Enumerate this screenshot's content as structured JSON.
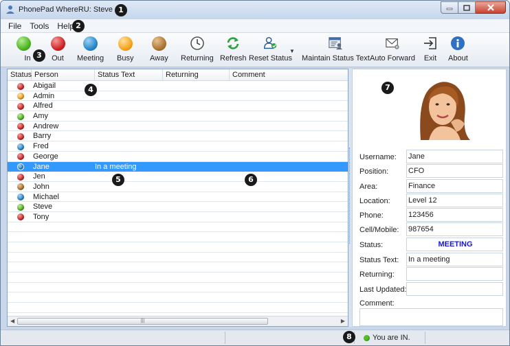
{
  "window": {
    "title": "PhonePad WhereRU: Steve"
  },
  "menu": [
    "File",
    "Tools",
    "Help"
  ],
  "toolbar": {
    "in": "In",
    "out": "Out",
    "meeting": "Meeting",
    "busy": "Busy",
    "away": "Away",
    "returning": "Returning",
    "refresh": "Refresh",
    "reset_status": "Reset Status",
    "maintain": "Maintain Status Text",
    "auto_forward": "Auto Forward",
    "exit": "Exit",
    "about": "About"
  },
  "colors": {
    "in": "#59c42a",
    "out": "#d22a2a",
    "meeting": "#2b86c9",
    "busy": "#f5a623",
    "away": "#b07a3a",
    "selection": "#3399ff",
    "status_text": "#1515d6"
  },
  "grid": {
    "columns": [
      "Status",
      "Person",
      "Status Text",
      "Returning",
      "Comment"
    ],
    "rows": [
      {
        "name": "Abigail",
        "status": "out",
        "status_text": ""
      },
      {
        "name": "Admin",
        "status": "busy",
        "status_text": ""
      },
      {
        "name": "Alfred",
        "status": "out",
        "status_text": ""
      },
      {
        "name": "Amy",
        "status": "in",
        "status_text": ""
      },
      {
        "name": "Andrew",
        "status": "out",
        "status_text": ""
      },
      {
        "name": "Barry",
        "status": "out",
        "status_text": ""
      },
      {
        "name": "Fred",
        "status": "meeting",
        "status_text": ""
      },
      {
        "name": "George",
        "status": "out",
        "status_text": ""
      },
      {
        "name": "Jane",
        "status": "meeting",
        "status_text": "In a meeting",
        "selected": true
      },
      {
        "name": "Jen",
        "status": "out",
        "status_text": ""
      },
      {
        "name": "John",
        "status": "away",
        "status_text": ""
      },
      {
        "name": "Michael",
        "status": "meeting",
        "status_text": ""
      },
      {
        "name": "Steve",
        "status": "in",
        "status_text": ""
      },
      {
        "name": "Tony",
        "status": "out",
        "status_text": ""
      }
    ],
    "blank_rows": 9
  },
  "detail": {
    "labels": {
      "username": "Username:",
      "position": "Position:",
      "area": "Area:",
      "location": "Location:",
      "phone": "Phone:",
      "cell": "Cell/Mobile:",
      "status": "Status:",
      "status_text": "Status Text:",
      "returning": "Returning:",
      "last_updated": "Last Updated:",
      "comment": "Comment:"
    },
    "values": {
      "username": "Jane",
      "position": "CFO",
      "area": "Finance",
      "location": "Level 12",
      "phone": "123456",
      "cell": "987654",
      "status": "MEETING",
      "status_text": "In a meeting",
      "returning": "",
      "last_updated": ""
    }
  },
  "statusbar": {
    "text": "You are IN."
  },
  "callouts": [
    "1",
    "2",
    "3",
    "4",
    "5",
    "6",
    "7",
    "8"
  ]
}
